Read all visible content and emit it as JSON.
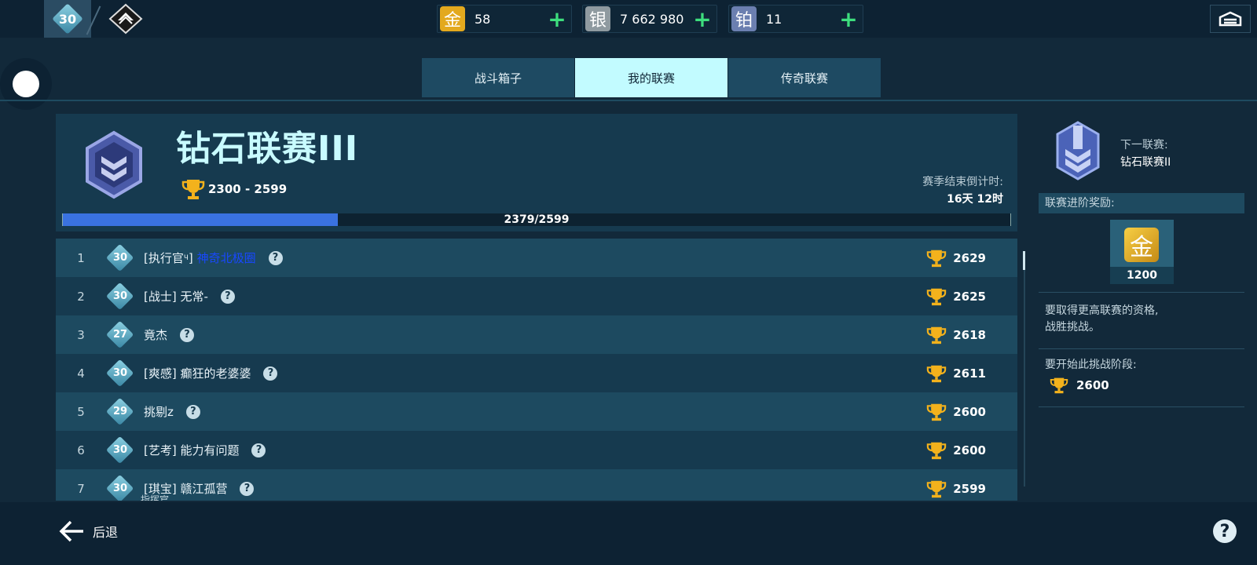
{
  "player": {
    "level": "30"
  },
  "currencies": [
    {
      "icon_glyph": "金",
      "icon": "gold-icon",
      "color": "#e3a91e",
      "value": "58"
    },
    {
      "icon_glyph": "银",
      "icon": "silver-icon",
      "color": "#8f9aa0",
      "value": "7 662 980"
    },
    {
      "icon_glyph": "铂",
      "icon": "platinum-icon",
      "color": "#6b7fb0",
      "value": "11"
    }
  ],
  "tabs": [
    {
      "label": "战斗箱子",
      "active": false
    },
    {
      "label": "我的联赛",
      "active": true
    },
    {
      "label": "传奇联赛",
      "active": false
    }
  ],
  "league": {
    "title": "钻石联赛III",
    "trophy_range": "2300 - 2599",
    "season_label": "赛季结束倒计时:",
    "season_time": "16天 12时",
    "progress_text": "2379/2599",
    "progress_fraction": 0.29
  },
  "ranking": [
    {
      "pos": "1",
      "level": "30",
      "prefix": "[执行官ᶣ]",
      "highlight": "神奇北极圈",
      "name": "",
      "sub": "",
      "score": "2629"
    },
    {
      "pos": "2",
      "level": "30",
      "prefix": "",
      "highlight": "",
      "name": "[战士] 无常-",
      "sub": "",
      "score": "2625"
    },
    {
      "pos": "3",
      "level": "27",
      "prefix": "",
      "highlight": "",
      "name": "竟杰",
      "sub": "",
      "score": "2618"
    },
    {
      "pos": "4",
      "level": "30",
      "prefix": "",
      "highlight": "",
      "name": "[爽感] 癫狂的老婆婆",
      "sub": "",
      "score": "2611"
    },
    {
      "pos": "5",
      "level": "29",
      "prefix": "",
      "highlight": "",
      "name": "挑剔z",
      "sub": "",
      "score": "2600"
    },
    {
      "pos": "6",
      "level": "30",
      "prefix": "",
      "highlight": "",
      "name": "[艺考] 能力有问题",
      "sub": "",
      "score": "2600"
    },
    {
      "pos": "7",
      "level": "30",
      "prefix": "",
      "highlight": "",
      "name": "[琪宝] 赣江孤营",
      "sub": "指挥官",
      "score": "2599"
    }
  ],
  "next_league": {
    "label": "下一联赛:",
    "value": "钻石联赛II"
  },
  "rewards": {
    "header": "联赛进阶奖励:",
    "icon_glyph": "金",
    "amount": "1200"
  },
  "requirements": {
    "text1_line1": "要取得更高联赛的资格,",
    "text1_line2": "战胜挑战。",
    "text2": "要开始此挑战阶段:",
    "value": "2600"
  },
  "bottom": {
    "back_label": "后退",
    "help_glyph": "?"
  },
  "help_glyph": "?",
  "plus_glyph": "+"
}
